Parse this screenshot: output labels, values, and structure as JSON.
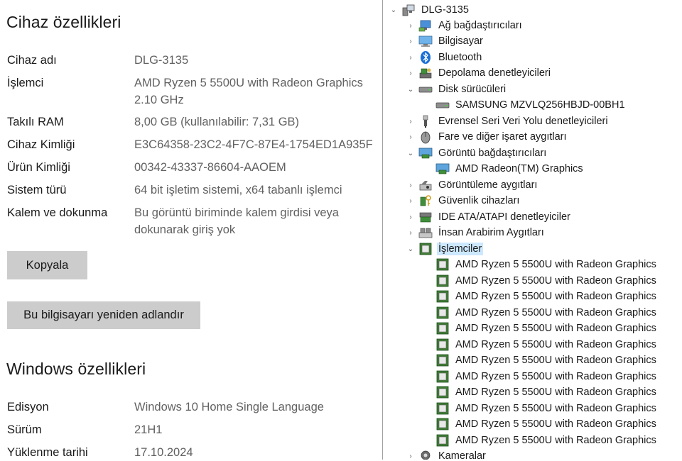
{
  "device_specs": {
    "title": "Cihaz özellikleri",
    "rows": [
      {
        "label": "Cihaz adı",
        "value": "DLG-3135"
      },
      {
        "label": "İşlemci",
        "value": "AMD Ryzen 5 5500U with Radeon Graphics 2.10 GHz"
      },
      {
        "label": "Takılı RAM",
        "value": "8,00 GB (kullanılabilir: 7,31 GB)"
      },
      {
        "label": "Cihaz Kimliği",
        "value": "E3C64358-23C2-4F7C-87E4-1754ED1A935F"
      },
      {
        "label": "Ürün Kimliği",
        "value": "00342-43337-86604-AAOEM"
      },
      {
        "label": "Sistem türü",
        "value": "64 bit işletim sistemi, x64 tabanlı işlemci"
      },
      {
        "label": "Kalem ve dokunma",
        "value": "Bu görüntü biriminde kalem girdisi veya dokunarak giriş yok"
      }
    ],
    "copy_button": "Kopyala",
    "rename_button": "Bu bilgisayarı yeniden adlandır"
  },
  "windows_specs": {
    "title": "Windows özellikleri",
    "rows": [
      {
        "label": "Edisyon",
        "value": "Windows 10 Home Single Language"
      },
      {
        "label": "Sürüm",
        "value": "21H1"
      },
      {
        "label": "Yüklenme tarihi",
        "value": "17.10.2024"
      }
    ]
  },
  "device_manager": {
    "root": {
      "label": "DLG-3135",
      "icon": "computer-icon",
      "expanded": true
    },
    "nodes": [
      {
        "label": "Ağ bağdaştırıcıları",
        "icon": "network-adapter-icon",
        "expanded": false
      },
      {
        "label": "Bilgisayar",
        "icon": "monitor-icon",
        "expanded": false
      },
      {
        "label": "Bluetooth",
        "icon": "bluetooth-icon",
        "expanded": false
      },
      {
        "label": "Depolama denetleyicileri",
        "icon": "storage-controller-icon",
        "expanded": false
      },
      {
        "label": "Disk sürücüleri",
        "icon": "disk-drive-icon",
        "expanded": true,
        "children": [
          {
            "label": "SAMSUNG MZVLQ256HBJD-00BH1",
            "icon": "disk-drive-icon"
          }
        ]
      },
      {
        "label": "Evrensel Seri Veri Yolu denetleyicileri",
        "icon": "usb-icon",
        "expanded": false
      },
      {
        "label": "Fare ve diğer işaret aygıtları",
        "icon": "mouse-icon",
        "expanded": false
      },
      {
        "label": "Görüntü bağdaştırıcıları",
        "icon": "display-adapter-icon",
        "expanded": true,
        "children": [
          {
            "label": "AMD Radeon(TM) Graphics",
            "icon": "display-adapter-icon"
          }
        ]
      },
      {
        "label": "Görüntüleme aygıtları",
        "icon": "camera-device-icon",
        "expanded": false
      },
      {
        "label": "Güvenlik cihazları",
        "icon": "security-key-icon",
        "expanded": false
      },
      {
        "label": "IDE ATA/ATAPI denetleyiciler",
        "icon": "ide-controller-icon",
        "expanded": false
      },
      {
        "label": "İnsan Arabirim Aygıtları",
        "icon": "hid-icon",
        "expanded": false
      },
      {
        "label": "İşlemciler",
        "icon": "processor-icon",
        "expanded": true,
        "selected": true,
        "children": [
          {
            "label": "AMD Ryzen 5 5500U with Radeon Graphics",
            "icon": "processor-icon"
          },
          {
            "label": "AMD Ryzen 5 5500U with Radeon Graphics",
            "icon": "processor-icon"
          },
          {
            "label": "AMD Ryzen 5 5500U with Radeon Graphics",
            "icon": "processor-icon"
          },
          {
            "label": "AMD Ryzen 5 5500U with Radeon Graphics",
            "icon": "processor-icon"
          },
          {
            "label": "AMD Ryzen 5 5500U with Radeon Graphics",
            "icon": "processor-icon"
          },
          {
            "label": "AMD Ryzen 5 5500U with Radeon Graphics",
            "icon": "processor-icon"
          },
          {
            "label": "AMD Ryzen 5 5500U with Radeon Graphics",
            "icon": "processor-icon"
          },
          {
            "label": "AMD Ryzen 5 5500U with Radeon Graphics",
            "icon": "processor-icon"
          },
          {
            "label": "AMD Ryzen 5 5500U with Radeon Graphics",
            "icon": "processor-icon"
          },
          {
            "label": "AMD Ryzen 5 5500U with Radeon Graphics",
            "icon": "processor-icon"
          },
          {
            "label": "AMD Ryzen 5 5500U with Radeon Graphics",
            "icon": "processor-icon"
          },
          {
            "label": "AMD Ryzen 5 5500U with Radeon Graphics",
            "icon": "processor-icon"
          }
        ]
      },
      {
        "label": "Kameralar",
        "icon": "webcam-icon",
        "expanded": false
      }
    ]
  },
  "colors": {
    "selection": "#cce8ff",
    "button": "#cccccc",
    "value_text": "#616161"
  }
}
